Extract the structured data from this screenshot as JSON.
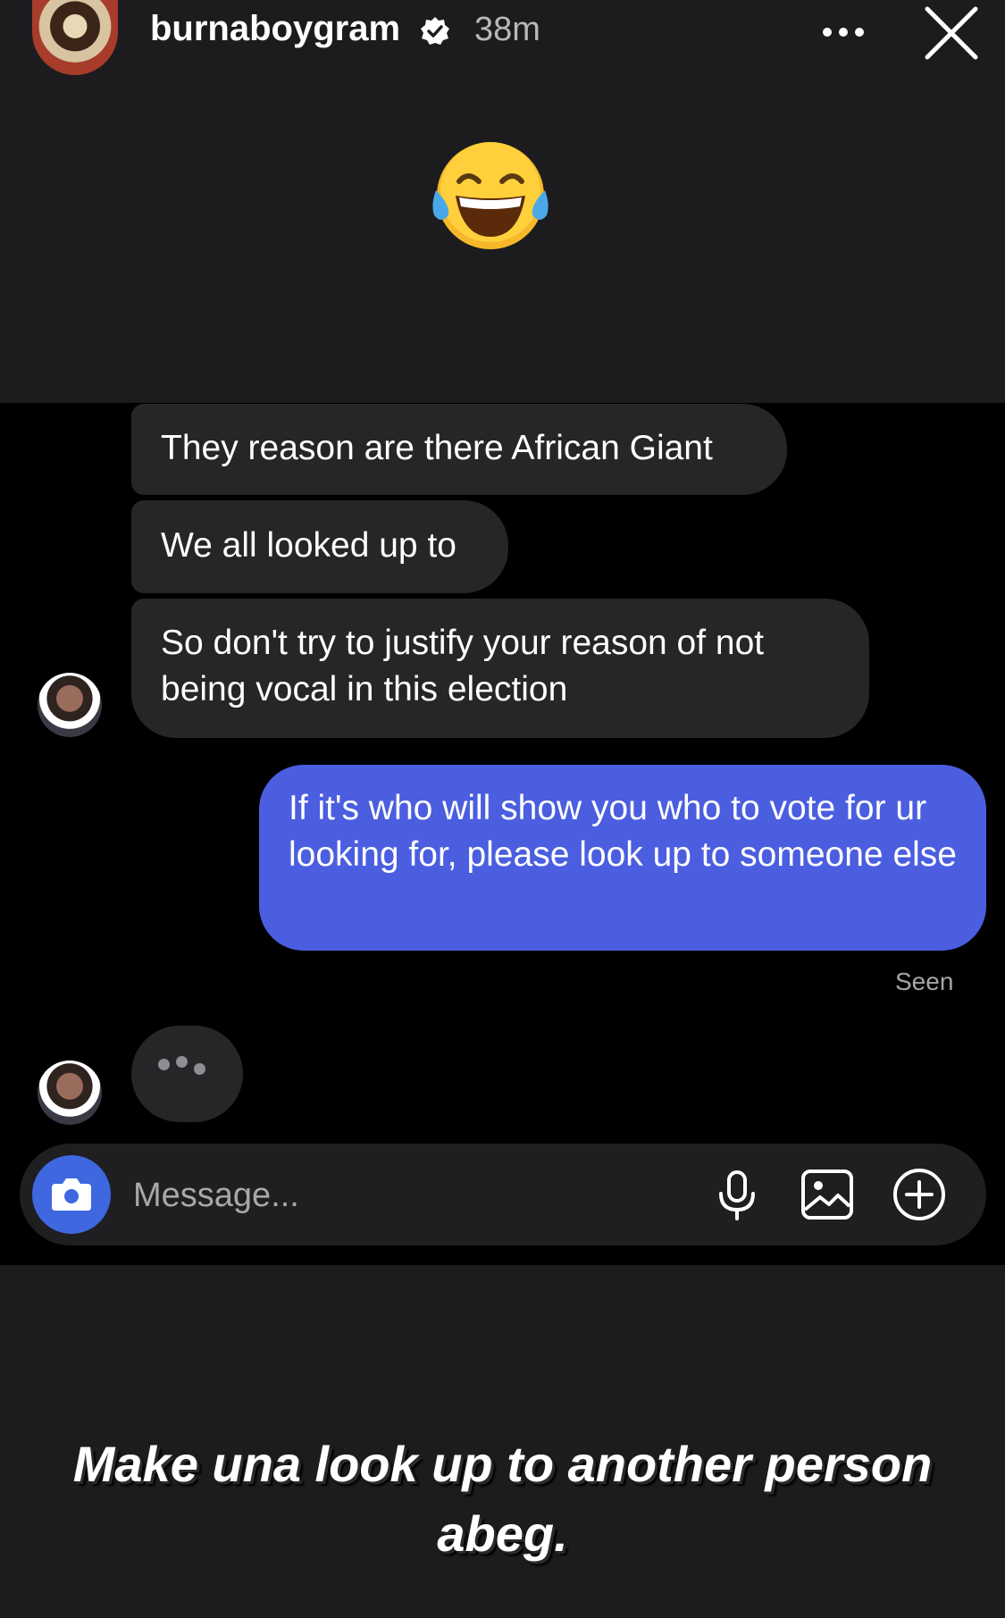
{
  "story": {
    "username": "burnaboygram",
    "time_ago": "38m",
    "emoji": "😂",
    "caption": "Make una look up to another person abeg."
  },
  "dm": {
    "received": [
      "They reason are there African Giant",
      "We all looked up to",
      "So don't try to justify your reason of not being vocal in this election"
    ],
    "sent": "If it's who will show you who to vote for ur looking for, please look up to someone else",
    "seen_label": "Seen",
    "composer_placeholder": "Message..."
  },
  "colors": {
    "sent_bubble": "#4b5ee0",
    "received_bubble": "#262628",
    "camera_button": "#3e67e0",
    "background": "#1c1c1e"
  },
  "icons": [
    "verified-icon",
    "more-icon",
    "close-icon",
    "camera-icon",
    "mic-icon",
    "gallery-icon",
    "plus-icon"
  ]
}
